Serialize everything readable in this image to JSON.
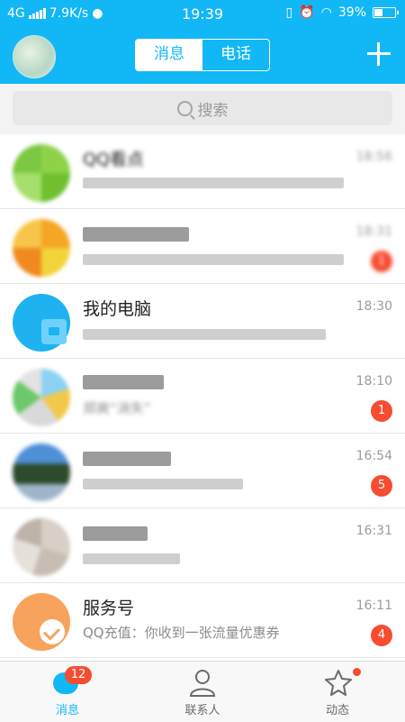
{
  "status_bar": {
    "network": "4G",
    "speed": "7.9K/s",
    "time": "19:39",
    "battery": "39%"
  },
  "header": {
    "tab_messages": "消息",
    "tab_calls": "电话"
  },
  "search": {
    "placeholder": "搜索"
  },
  "conversations": [
    {
      "name": "QQ看点",
      "time": "18:56",
      "blurred": true
    },
    {
      "name": "",
      "time": "18:31",
      "badge": "1",
      "blurred": true
    },
    {
      "name": "我的电脑",
      "time": "18:30",
      "blurred_message": true
    },
    {
      "name": "",
      "message": "郑爽“消失”",
      "time": "18:10",
      "badge": "1",
      "blurred": true
    },
    {
      "name": "",
      "time": "16:54",
      "badge": "5",
      "blurred": true
    },
    {
      "name": "",
      "time": "16:31",
      "blurred": true
    },
    {
      "name": "服务号",
      "message": "QQ充值：你收到一张流量优惠券",
      "time": "16:11",
      "badge": "4"
    }
  ],
  "bottom_nav": {
    "messages_label": "消息",
    "messages_badge": "12",
    "contacts_label": "联系人",
    "activity_label": "动态"
  },
  "colors": {
    "brand": "#12b7f5",
    "badge": "#f74c31",
    "service_avatar": "#f7a35c"
  }
}
